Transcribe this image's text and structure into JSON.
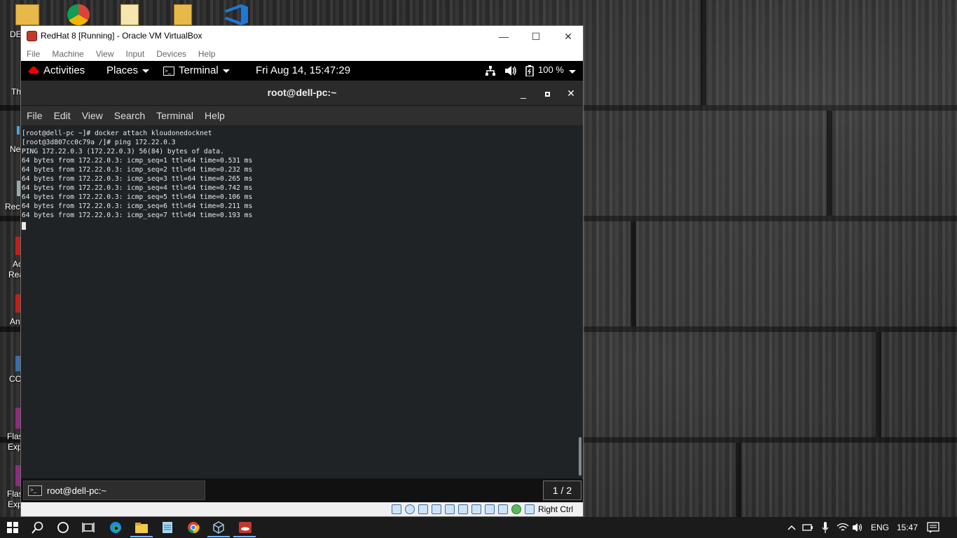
{
  "desktop": {
    "labels": [
      "DE",
      "Th",
      "Ne",
      "Recy",
      "Ac",
      "Rea",
      "An",
      "CC",
      "Flas",
      "Exp",
      "Flas",
      "Exp"
    ]
  },
  "vbox": {
    "title": "RedHat 8 [Running] - Oracle VM VirtualBox",
    "menu": [
      "File",
      "Machine",
      "View",
      "Input",
      "Devices",
      "Help"
    ],
    "minimize": "—",
    "maximize": "☐",
    "close": "✕",
    "host_key": "Right Ctrl"
  },
  "gnome": {
    "activities": "Activities",
    "places": "Places",
    "terminal_app": "Terminal",
    "clock": "Fri Aug 14, 15:47:29",
    "battery": "100 %"
  },
  "terminal": {
    "title": "root@dell-pc:~",
    "menu": [
      "File",
      "Edit",
      "View",
      "Search",
      "Terminal",
      "Help"
    ],
    "lines": [
      "[root@dell-pc ~]# docker attach kloudonedocknet",
      "[root@3d807cc0c79a /]# ping 172.22.0.3",
      "PING 172.22.0.3 (172.22.0.3) 56(84) bytes of data.",
      "64 bytes from 172.22.0.3: icmp_seq=1 ttl=64 time=0.531 ms",
      "64 bytes from 172.22.0.3: icmp_seq=2 ttl=64 time=0.232 ms",
      "64 bytes from 172.22.0.3: icmp_seq=3 ttl=64 time=0.265 ms",
      "64 bytes from 172.22.0.3: icmp_seq=4 ttl=64 time=0.742 ms",
      "64 bytes from 172.22.0.3: icmp_seq=5 ttl=64 time=0.106 ms",
      "64 bytes from 172.22.0.3: icmp_seq=6 ttl=64 time=0.211 ms",
      "64 bytes from 172.22.0.3: icmp_seq=7 ttl=64 time=0.193 ms"
    ]
  },
  "bottom_bar": {
    "task_label": "root@dell-pc:~",
    "workspace": "1 / 2"
  },
  "taskbar": {
    "language": "ENG",
    "time": "15:47"
  },
  "colors": {
    "terminal_bg": "#1f2326",
    "redhat_red": "#ee0000",
    "taskbar_bg": "#1b1b1b"
  }
}
